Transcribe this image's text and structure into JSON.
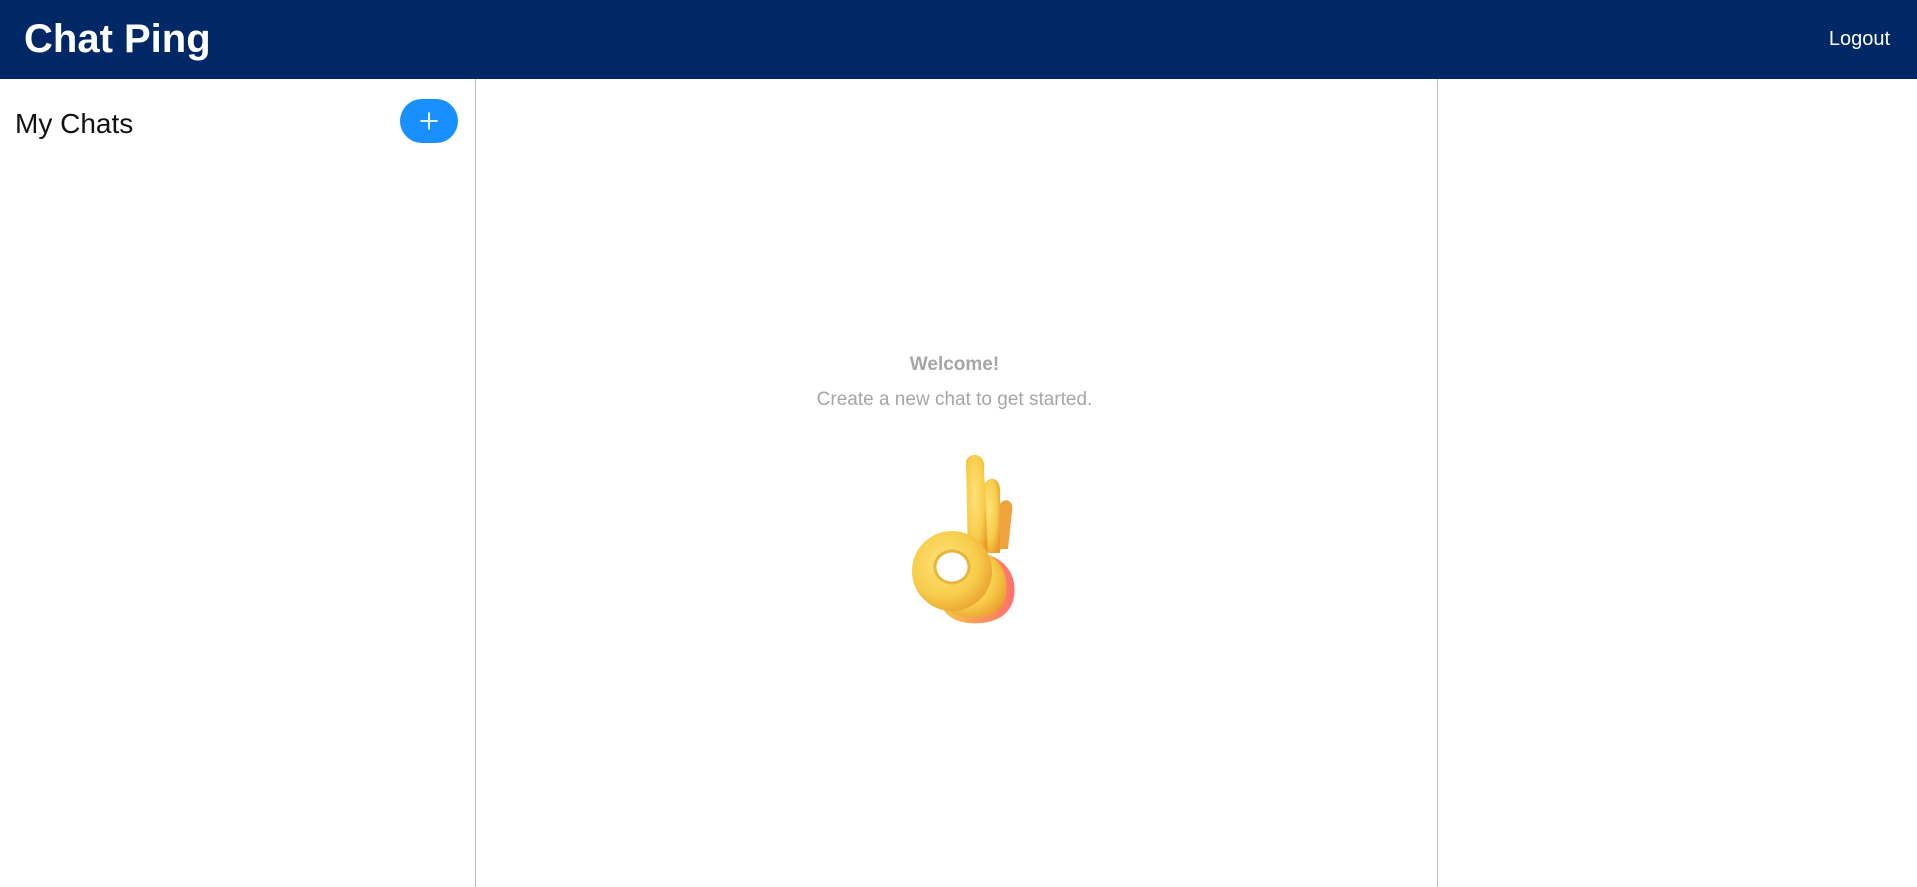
{
  "header": {
    "app_title": "Chat Ping",
    "logout_label": "Logout",
    "background_color": "#002766"
  },
  "sidebar": {
    "title": "My Chats",
    "new_chat_icon": "plus-icon",
    "accent_color": "#1890ff"
  },
  "main": {
    "welcome_title": "Welcome!",
    "welcome_subtitle": "Create a new chat to get started.",
    "illustration_icon": "ok-hand-emoji"
  }
}
